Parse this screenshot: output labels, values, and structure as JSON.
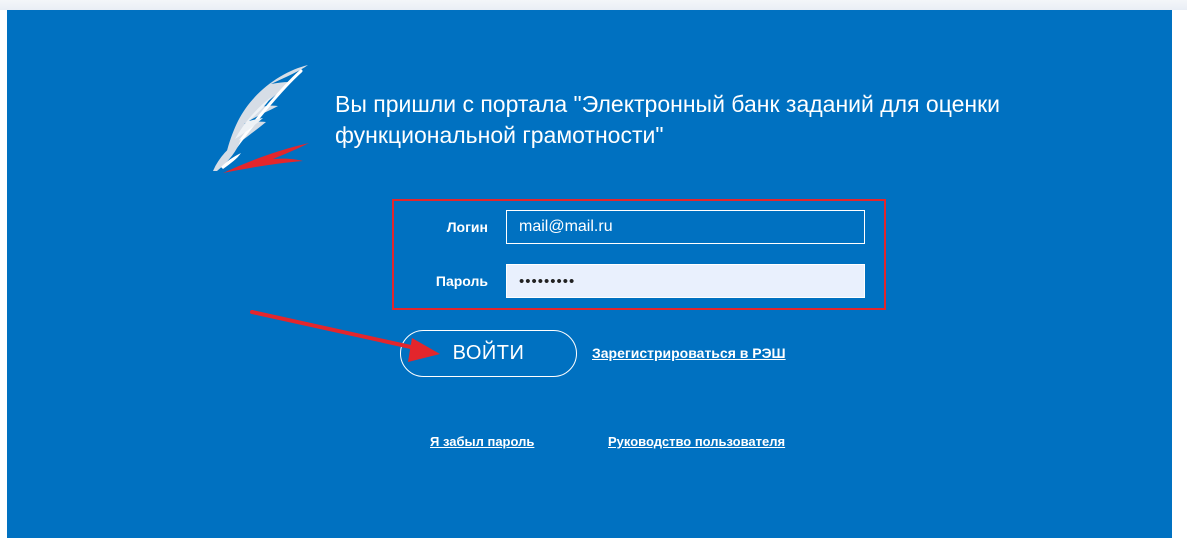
{
  "page": {
    "heading": "Вы пришли с портала \"Электронный банк заданий для оценки функциональной грамотности\"",
    "logo_icon": "quill-pen-logo-icon"
  },
  "login_form": {
    "login_label": "Логин",
    "login_value": "mail@mail.ru",
    "password_label": "Пароль",
    "password_value": "•••••••••",
    "submit_label": "ВОЙТИ",
    "highlight_color": "#e3262c"
  },
  "links": {
    "register": "Зарегистрироваться в РЭШ",
    "forgot_password": "Я забыл пароль",
    "user_guide": "Руководство пользователя"
  },
  "annotation": {
    "arrow_icon": "red-arrow-icon",
    "arrow_color": "#e3262c"
  },
  "colors": {
    "panel_background": "#0071c1",
    "text": "#ffffff",
    "password_field_background": "#e9f0fd"
  }
}
